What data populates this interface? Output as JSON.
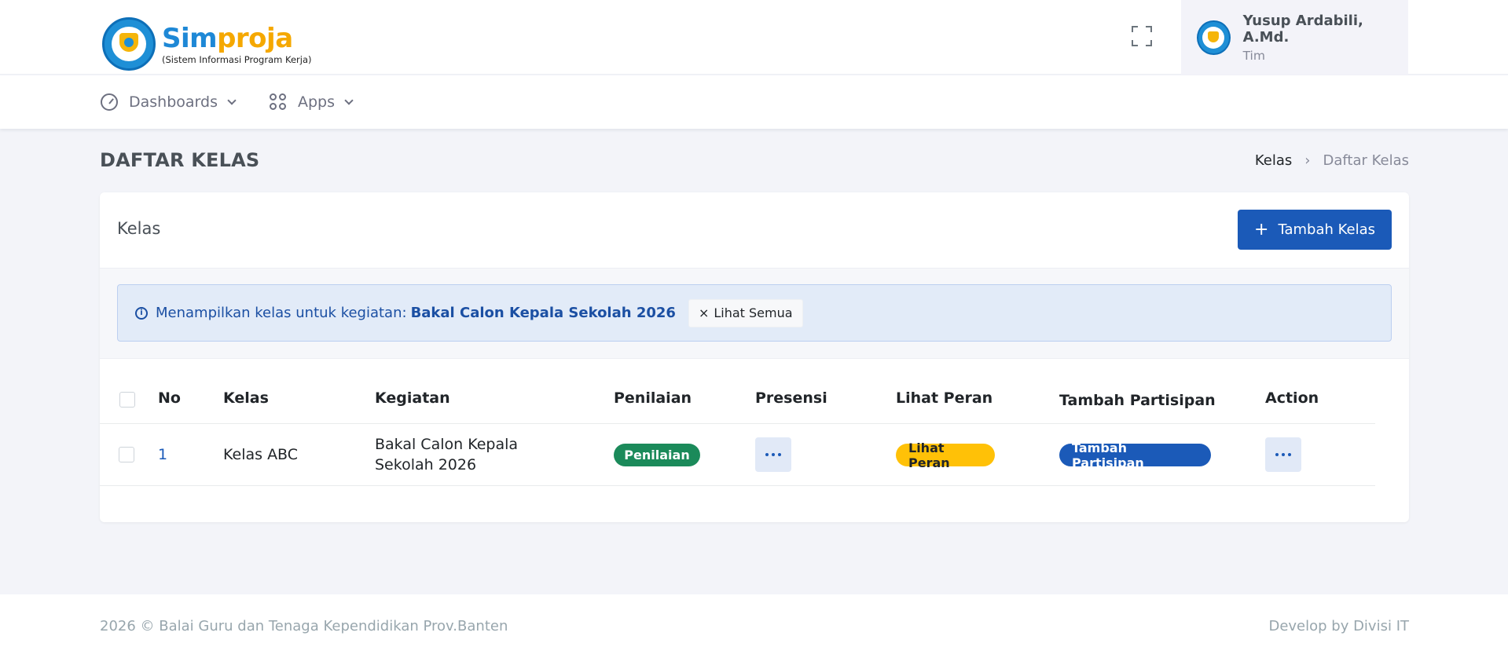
{
  "header": {
    "brand_part1": "Sim",
    "brand_part2": "proja",
    "brand_subtitle": "(Sistem Informasi Program Kerja)",
    "user_name": "Yusup Ardabili, A.Md.",
    "user_role": "Tim"
  },
  "nav": {
    "dashboards": "Dashboards",
    "apps": "Apps"
  },
  "page": {
    "title": "DAFTAR KELAS",
    "breadcrumb": [
      "Kelas",
      "Daftar Kelas"
    ]
  },
  "card": {
    "title": "Kelas",
    "add_button": "Tambah Kelas",
    "filter": {
      "message": "Menampilkan kelas untuk kegiatan:",
      "activity": "Bakal Calon Kepala Sekolah 2026",
      "clear_label": "Lihat Semua"
    }
  },
  "table": {
    "headers": [
      "No",
      "Kelas",
      "Kegiatan",
      "Penilaian",
      "Presensi",
      "Lihat Peran",
      "Tambah Partisipan",
      "Action"
    ],
    "rows": [
      {
        "no": "1",
        "kelas": "Kelas ABC",
        "kegiatan": "Bakal Calon Kepala Sekolah 2026",
        "penilaian": "Penilaian",
        "lihat_peran": "Lihat Peran",
        "tambah_partisipan": "Tambah Partisipan"
      }
    ]
  },
  "footer": {
    "left": "2026 © Balai Guru dan Tenaga Kependidikan Prov.Banten",
    "right": "Develop by Divisi IT"
  },
  "colors": {
    "primary": "#1b5ab8",
    "success": "#1b8a5a",
    "warning": "#ffc107",
    "brand_blue": "#1e88d6",
    "brand_orange": "#f5a800"
  }
}
